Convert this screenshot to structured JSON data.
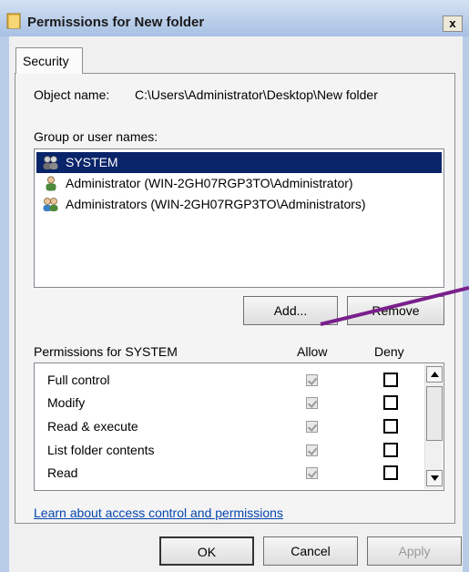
{
  "window": {
    "title": "Permissions for New folder",
    "close_label": "x"
  },
  "tabs": [
    {
      "label": "Security"
    }
  ],
  "object": {
    "label": "Object name:",
    "value": "C:\\Users\\Administrator\\Desktop\\New folder"
  },
  "group": {
    "label": "Group or user names:",
    "items": [
      {
        "name": "SYSTEM",
        "icon": "users-group-icon",
        "selected": true
      },
      {
        "name": "Administrator (WIN-2GH07RGP3TO\\Administrator)",
        "icon": "user-icon",
        "selected": false
      },
      {
        "name": "Administrators (WIN-2GH07RGP3TO\\Administrators)",
        "icon": "users-group-icon",
        "selected": false
      }
    ]
  },
  "buttons": {
    "add": "Add...",
    "remove": "Remove",
    "ok": "OK",
    "cancel": "Cancel",
    "apply": "Apply"
  },
  "permissions": {
    "header": "Permissions for SYSTEM",
    "allow_header": "Allow",
    "deny_header": "Deny",
    "rows": [
      {
        "name": "Full control",
        "allow": true,
        "deny": false
      },
      {
        "name": "Modify",
        "allow": true,
        "deny": false
      },
      {
        "name": "Read & execute",
        "allow": true,
        "deny": false
      },
      {
        "name": "List folder contents",
        "allow": true,
        "deny": false
      },
      {
        "name": "Read",
        "allow": true,
        "deny": false
      }
    ]
  },
  "link": {
    "text": "Learn about access control and permissions"
  },
  "colors": {
    "selection": "#0a246a",
    "annotation_line": "#7a1f8c",
    "link": "#0645ad"
  }
}
